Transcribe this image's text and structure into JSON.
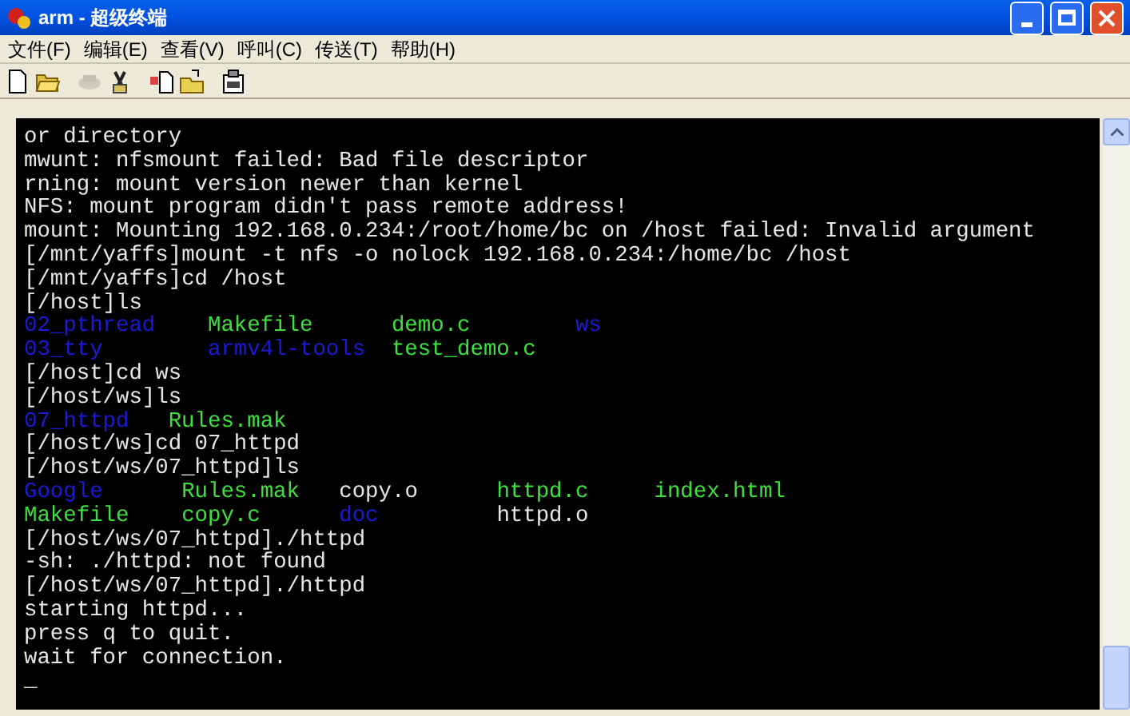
{
  "window": {
    "title": "arm - 超级终端"
  },
  "menu": [
    {
      "label": "文件(F)"
    },
    {
      "label": "编辑(E)"
    },
    {
      "label": "查看(V)"
    },
    {
      "label": "呼叫(C)"
    },
    {
      "label": "传送(T)"
    },
    {
      "label": "帮助(H)"
    }
  ],
  "toolbar": [
    {
      "kind": "new",
      "disabled": false
    },
    {
      "kind": "open",
      "disabled": false
    },
    {
      "kind": "call",
      "disabled": true
    },
    {
      "kind": "disconnect",
      "disabled": false
    },
    {
      "kind": "send",
      "disabled": false
    },
    {
      "kind": "receive",
      "disabled": false
    },
    {
      "kind": "properties",
      "disabled": false
    }
  ],
  "terminal": {
    "lines": [
      {
        "kind": "text",
        "text": "or directory"
      },
      {
        "kind": "text",
        "text": "mwunt: nfsmount failed: Bad file descriptor"
      },
      {
        "kind": "text",
        "text": "rning: mount version newer than kernel"
      },
      {
        "kind": "text",
        "text": "NFS: mount program didn't pass remote address!"
      },
      {
        "kind": "text",
        "text": "mount: Mounting 192.168.0.234:/root/home/bc on /host failed: Invalid argument"
      },
      {
        "kind": "text",
        "text": "[/mnt/yaffs]mount -t nfs -o nolock 192.168.0.234:/home/bc /host"
      },
      {
        "kind": "text",
        "text": "[/mnt/yaffs]cd /host"
      },
      {
        "kind": "text",
        "text": "[/host]ls"
      },
      {
        "kind": "listing",
        "rows": [
          [
            {
              "text": "02_pthread",
              "color": "#1a1ad8"
            },
            {
              "text": "Makefile",
              "color": "#3ee03e"
            },
            {
              "text": "demo.c",
              "color": "#3ee03e"
            },
            {
              "text": "ws",
              "color": "#1a1ad8"
            }
          ],
          [
            {
              "text": "03_tty",
              "color": "#1a1ad8"
            },
            {
              "text": "armv4l-tools",
              "color": "#1a1ad8"
            },
            {
              "text": "test_demo.c",
              "color": "#3ee03e"
            }
          ]
        ]
      },
      {
        "kind": "text",
        "text": "[/host]cd ws"
      },
      {
        "kind": "text",
        "text": "[/host/ws]ls"
      },
      {
        "kind": "listing",
        "rows": [
          [
            {
              "text": "07_httpd",
              "color": "#1a1ad8"
            },
            {
              "text": "Rules.mak",
              "color": "#3ee03e"
            }
          ]
        ]
      },
      {
        "kind": "text",
        "text": "[/host/ws]cd 07_httpd"
      },
      {
        "kind": "text",
        "text": "[/host/ws/07_httpd]ls"
      },
      {
        "kind": "listing",
        "rows": [
          [
            {
              "text": "Google",
              "color": "#1a1ad8"
            },
            {
              "text": "Rules.mak",
              "color": "#3ee03e"
            },
            {
              "text": "copy.o",
              "color": "#e6e6e6"
            },
            {
              "text": "httpd.c",
              "color": "#3ee03e"
            },
            {
              "text": "index.html",
              "color": "#3ee03e"
            }
          ],
          [
            {
              "text": "Makefile",
              "color": "#3ee03e"
            },
            {
              "text": "copy.c",
              "color": "#3ee03e"
            },
            {
              "text": "doc",
              "color": "#1a1ad8"
            },
            {
              "text": "httpd.o",
              "color": "#e6e6e6"
            }
          ]
        ]
      },
      {
        "kind": "text",
        "text": "[/host/ws/07_httpd]./httpd"
      },
      {
        "kind": "text",
        "text": "-sh: ./httpd: not found"
      },
      {
        "kind": "text",
        "text": "[/host/ws/07_httpd]./httpd"
      },
      {
        "kind": "text",
        "text": "starting httpd..."
      },
      {
        "kind": "text",
        "text": "press q to quit."
      },
      {
        "kind": "text",
        "text": "wait for connection."
      },
      {
        "kind": "text",
        "text": "_"
      }
    ]
  }
}
